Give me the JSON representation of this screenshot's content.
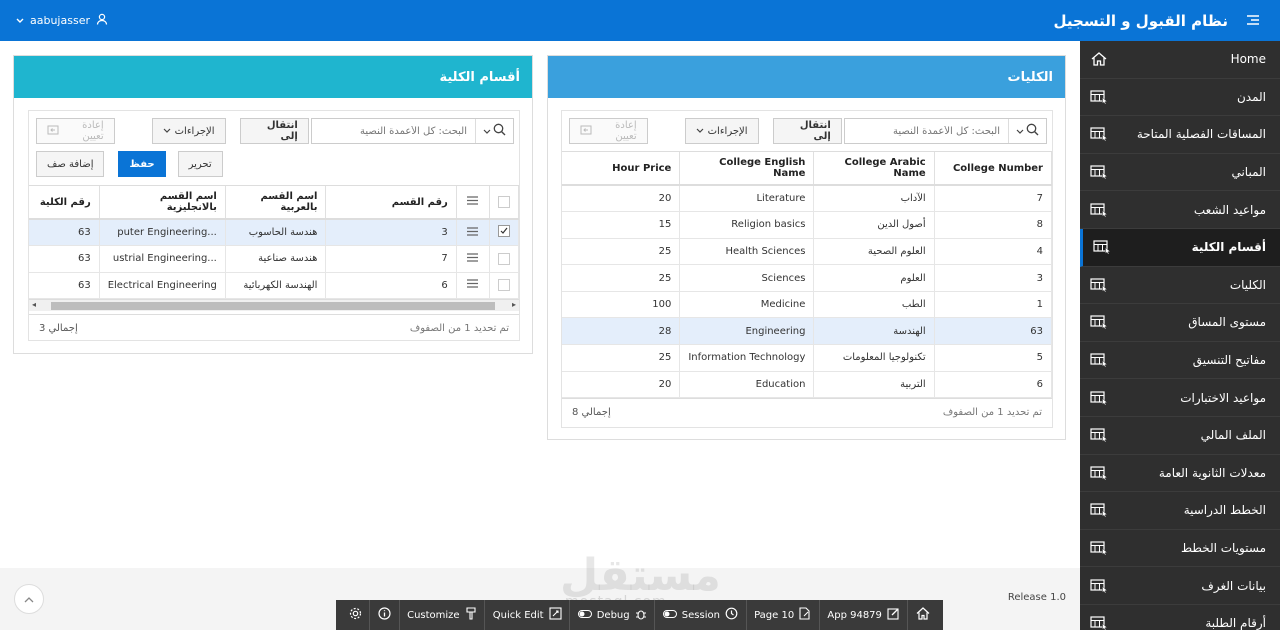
{
  "header": {
    "app_title": "نظام القبول و التسجيل",
    "username": "aabujasser"
  },
  "sidebar": {
    "items": [
      {
        "label": "Home",
        "icon": "home-icon",
        "active": false
      },
      {
        "label": "المدن",
        "icon": "report-icon",
        "active": false
      },
      {
        "label": "المساقات الفصلية المتاحة",
        "icon": "report-icon",
        "active": false
      },
      {
        "label": "المباني",
        "icon": "report-icon",
        "active": false
      },
      {
        "label": "مواعيد الشعب",
        "icon": "report-icon",
        "active": false
      },
      {
        "label": "أقسام الكلية",
        "icon": "report-icon",
        "active": true
      },
      {
        "label": "الكليات",
        "icon": "report-icon",
        "active": false
      },
      {
        "label": "مستوى المساق",
        "icon": "report-icon",
        "active": false
      },
      {
        "label": "مفاتيح التنسيق",
        "icon": "report-icon",
        "active": false
      },
      {
        "label": "مواعيد الاختبارات",
        "icon": "report-icon",
        "active": false
      },
      {
        "label": "الملف المالي",
        "icon": "report-icon",
        "active": false
      },
      {
        "label": "معدلات الثانوية العامة",
        "icon": "report-icon",
        "active": false
      },
      {
        "label": "الخطط الدراسية",
        "icon": "report-icon",
        "active": false
      },
      {
        "label": "مستويات الخطط",
        "icon": "report-icon",
        "active": false
      },
      {
        "label": "بيانات الغرف",
        "icon": "report-icon",
        "active": false
      },
      {
        "label": "أرقام الطلبة",
        "icon": "report-icon",
        "active": false
      }
    ]
  },
  "colleges": {
    "title": "الكليات",
    "search_placeholder": "البحث: كل الأعمدة النصية",
    "go_label": "انتقال إلى",
    "actions_label": "الإجراءات",
    "reset_label": "إعادة تعيين",
    "columns": [
      "College Number",
      "College Arabic Name",
      "College English Name",
      "Hour Price"
    ],
    "rows": [
      {
        "number": "7",
        "arabic": "الآداب",
        "english": "Literature",
        "price": "20",
        "selected": false
      },
      {
        "number": "8",
        "arabic": "أصول الدين",
        "english": "Religion basics",
        "price": "15",
        "selected": false
      },
      {
        "number": "4",
        "arabic": "العلوم الصحية",
        "english": "Health Sciences",
        "price": "25",
        "selected": false
      },
      {
        "number": "3",
        "arabic": "العلوم",
        "english": "Sciences",
        "price": "25",
        "selected": false
      },
      {
        "number": "1",
        "arabic": "الطب",
        "english": "Medicine",
        "price": "100",
        "selected": false
      },
      {
        "number": "63",
        "arabic": "الهندسة",
        "english": "Engineering",
        "price": "28",
        "selected": true
      },
      {
        "number": "5",
        "arabic": "تكنولوجيا المعلومات",
        "english": "Information Technology",
        "price": "25",
        "selected": false
      },
      {
        "number": "6",
        "arabic": "التربية",
        "english": "Education",
        "price": "20",
        "selected": false
      }
    ],
    "status": "تم تحديد 1 من الصفوف",
    "total": "إجمالي 8"
  },
  "departments": {
    "title": "أقسام الكلية",
    "search_placeholder": "البحث: كل الأعمدة النصية",
    "go_label": "انتقال إلى",
    "actions_label": "الإجراءات",
    "reset_label": "إعادة تعيين",
    "edit_label": "تحرير",
    "save_label": "حفظ",
    "add_row_label": "إضافة صف",
    "columns": [
      "رقم القسم",
      "اسم القسم بالعربية",
      "اسم القسم بالانجليزية",
      "رقم الكلية"
    ],
    "rows": [
      {
        "number": "3",
        "arabic": "هندسة الحاسوب",
        "english": "puter Engineering...",
        "college": "63",
        "selected": true
      },
      {
        "number": "7",
        "arabic": "هندسة صناعية",
        "english": "ustrial Engineering...",
        "college": "63",
        "selected": false
      },
      {
        "number": "6",
        "arabic": "الهندسة الكهربائية",
        "english": "Electrical Engineering",
        "college": "63",
        "selected": false
      }
    ],
    "status": "تم تحديد 1 من الصفوف",
    "total": "إجمالي 3"
  },
  "footer": {
    "release": "Release 1.0",
    "watermark": "مستقل",
    "watermark_sub": "mostaql.com",
    "devbar": [
      {
        "label": "",
        "icon": "home-icon"
      },
      {
        "label": "App 94879",
        "icon": "edit-icon"
      },
      {
        "label": "Page 10",
        "icon": "page-edit-icon"
      },
      {
        "label": "Session",
        "icon": "clock-icon"
      },
      {
        "label": "Debug",
        "icon": "bug-icon"
      },
      {
        "label": "Quick Edit",
        "icon": "quick-edit-icon"
      },
      {
        "label": "Customize",
        "icon": "brush-icon"
      },
      {
        "label": "",
        "icon": "info-icon"
      },
      {
        "label": "",
        "icon": "gear-icon"
      }
    ]
  },
  "colors": {
    "header_bg": "#0a74d6",
    "sidebar_bg": "#2f2f2f",
    "colleges_header": "#3aa0dd",
    "departments_header": "#1fb5cf",
    "selected_row": "#e4eefb"
  }
}
